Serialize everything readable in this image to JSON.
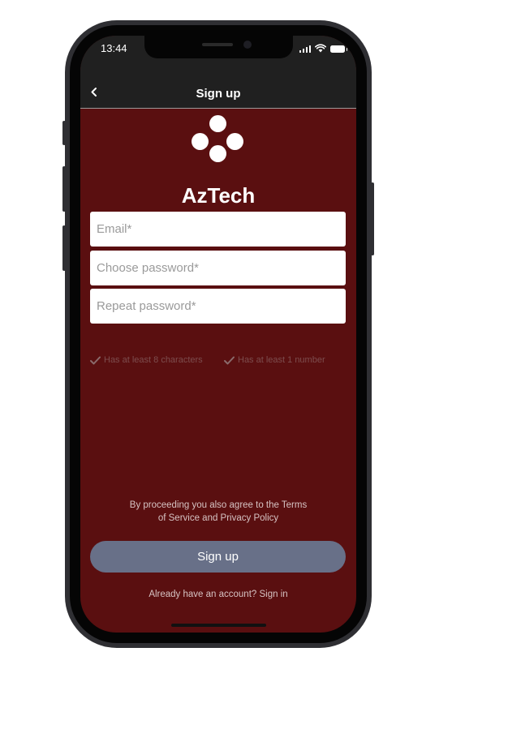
{
  "status_bar": {
    "time": "13:44",
    "signal_icon": "cellular-signal-icon",
    "wifi_icon": "wifi-icon",
    "battery_icon": "battery-icon"
  },
  "nav": {
    "back_icon": "chevron-left-icon",
    "title": "Sign up"
  },
  "brand": {
    "logo_icon": "four-dots-logo-icon",
    "name": "AzTech"
  },
  "form": {
    "email_placeholder": "Email*",
    "password_placeholder": "Choose password*",
    "repeat_placeholder": "Repeat password*"
  },
  "requirements": [
    {
      "icon": "checkmark-icon",
      "label": "Has at least 8 characters"
    },
    {
      "icon": "checkmark-icon",
      "label": "Has at least 1 number"
    }
  ],
  "terms": {
    "line1": "By proceeding you also agree to the Terms",
    "line2": "of Service and Privacy Policy"
  },
  "signup_button": {
    "label": "Sign up"
  },
  "signin": {
    "prompt": "Already have an account?",
    "link": "Sign in"
  },
  "colors": {
    "screen_background": "#5a0f10",
    "bar_background": "#202020",
    "button_background": "#687088",
    "requirement_text": "#7d4d4e"
  }
}
